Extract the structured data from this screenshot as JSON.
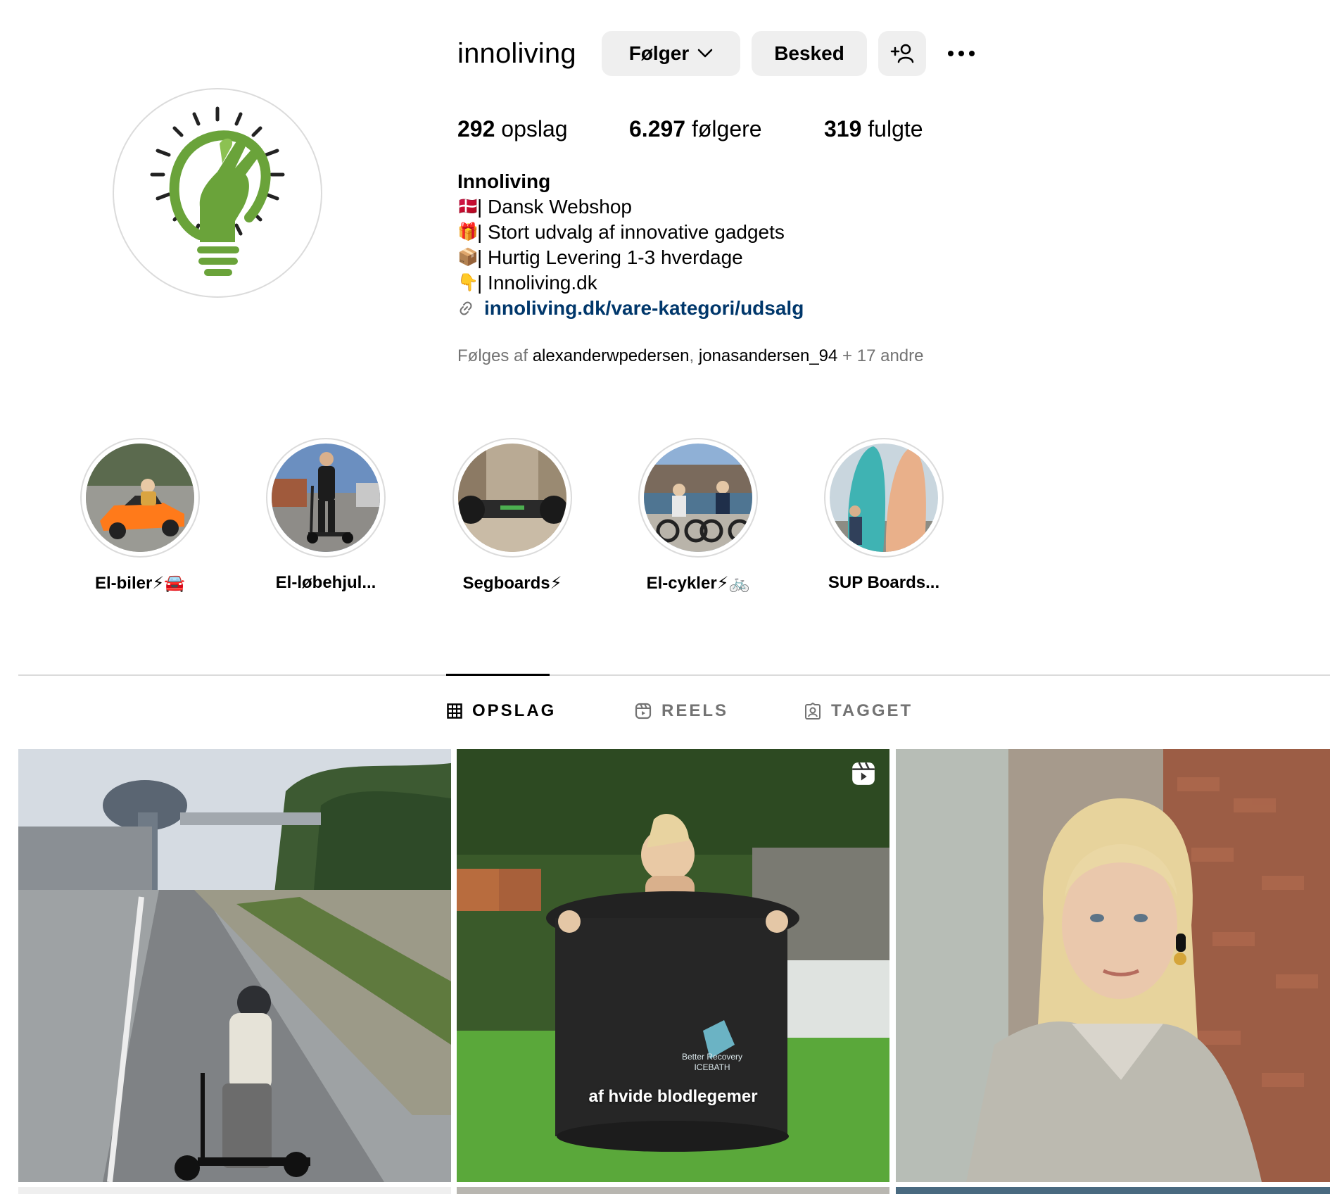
{
  "profile": {
    "username": "innoliving",
    "follow_label": "Følger",
    "message_label": "Besked",
    "posts_count": "292",
    "posts_label": " opslag",
    "followers_count": "6.297",
    "followers_label": " følgere",
    "following_count": "319",
    "following_label": " fulgte"
  },
  "bio": {
    "name": "Innoliving",
    "lines": [
      {
        "emoji": "🇩🇰",
        "text": "| Dansk Webshop"
      },
      {
        "emoji": "🎁",
        "text": "| Stort udvalg af innovative gadgets"
      },
      {
        "emoji": "📦",
        "text": "| Hurtig Levering 1-3 hverdage"
      },
      {
        "emoji": "👇",
        "text": "| Innoliving.dk"
      }
    ],
    "link": "innoliving.dk/vare-kategori/udsalg"
  },
  "followed_by": {
    "prefix": "Følges af ",
    "user1": "alexanderwpedersen",
    "sep": ", ",
    "user2": "jonasandersen_94",
    "suffix": " + 17 andre"
  },
  "highlights": [
    {
      "label": "El-biler",
      "symbols": "⚡🚘"
    },
    {
      "label": "El-løbehjul...",
      "symbols": ""
    },
    {
      "label": "Segboards",
      "symbols": "⚡"
    },
    {
      "label": "El-cykler",
      "symbols": "⚡🚲"
    },
    {
      "label": "SUP Boards...",
      "symbols": ""
    }
  ],
  "tabs": {
    "posts": "OPSLAG",
    "reels": "REELS",
    "tagged": "TAGGET"
  },
  "posts": [
    {
      "overlay": ""
    },
    {
      "overlay": "af hvide blodlegemer",
      "brand_line1": "Better Recovery",
      "brand_line2": "ICEBATH"
    },
    {
      "overlay": ""
    }
  ],
  "colors": {
    "brand_green": "#6aa33a",
    "link": "#00376b",
    "muted": "#737373",
    "button_bg": "#efefef"
  },
  "icons": [
    "chevron-down-icon",
    "add-user-icon",
    "more-icon",
    "link-icon",
    "grid-icon",
    "reels-icon",
    "tagged-icon",
    "reel-badge-icon",
    "lightbulb-hand-logo"
  ]
}
